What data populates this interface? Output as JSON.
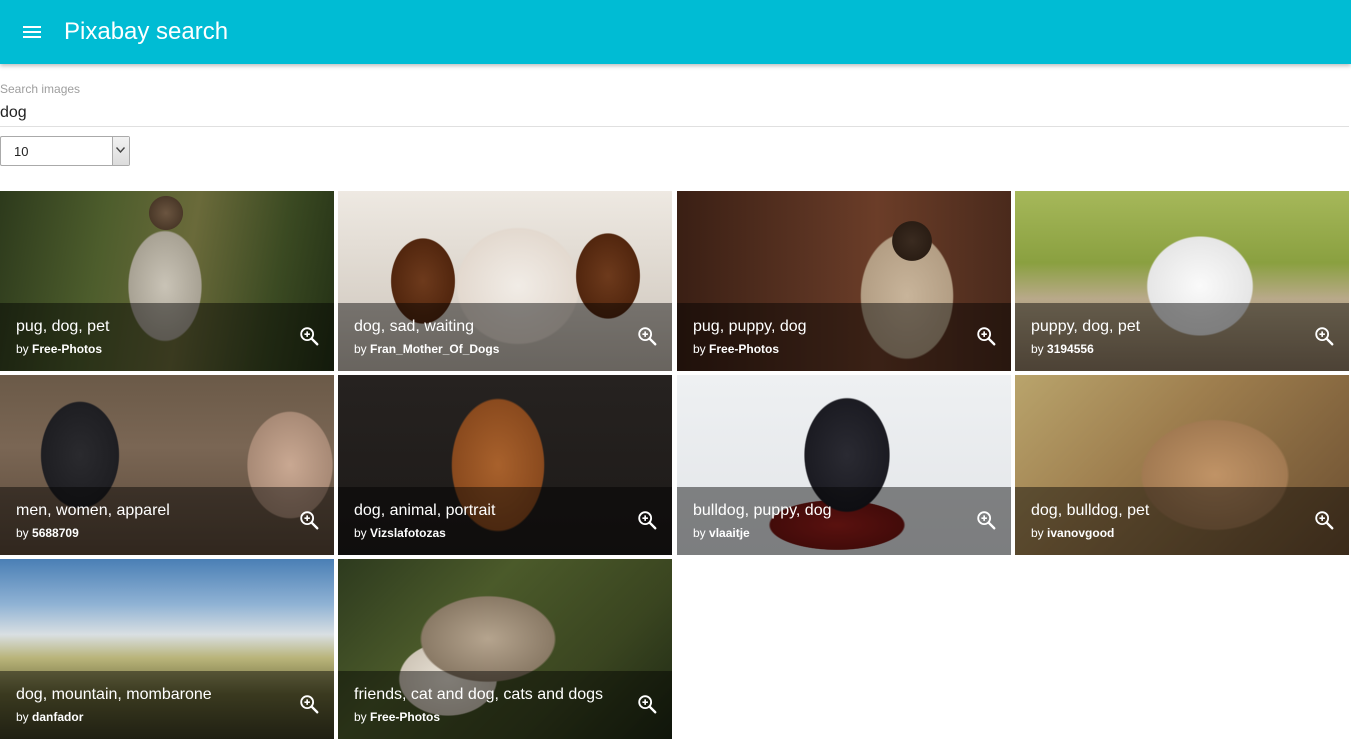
{
  "colors": {
    "accent": "#00bcd4"
  },
  "appbar": {
    "menu_icon": "menu-icon",
    "title": "Pixabay search"
  },
  "search": {
    "label": "Search images",
    "value": "dog"
  },
  "amount": {
    "selected": "10"
  },
  "results": [
    {
      "tags": "pug, dog, pet",
      "by": "by",
      "user": "Free-Photos",
      "zoom_icon": "zoom-in-icon"
    },
    {
      "tags": "dog, sad, waiting",
      "by": "by",
      "user": "Fran_Mother_Of_Dogs",
      "zoom_icon": "zoom-in-icon"
    },
    {
      "tags": "pug, puppy, dog",
      "by": "by",
      "user": "Free-Photos",
      "zoom_icon": "zoom-in-icon"
    },
    {
      "tags": "puppy, dog, pet",
      "by": "by",
      "user": "3194556",
      "zoom_icon": "zoom-in-icon"
    },
    {
      "tags": "men, women, apparel",
      "by": "by",
      "user": "5688709",
      "zoom_icon": "zoom-in-icon"
    },
    {
      "tags": "dog, animal, portrait",
      "by": "by",
      "user": "Vizslafotozas",
      "zoom_icon": "zoom-in-icon"
    },
    {
      "tags": "bulldog, puppy, dog",
      "by": "by",
      "user": "vlaaitje",
      "zoom_icon": "zoom-in-icon"
    },
    {
      "tags": "dog, bulldog, pet",
      "by": "by",
      "user": "ivanovgood",
      "zoom_icon": "zoom-in-icon"
    },
    {
      "tags": "dog, mountain, mombarone",
      "by": "by",
      "user": "danfador",
      "zoom_icon": "zoom-in-icon"
    },
    {
      "tags": "friends, cat and dog, cats and dogs",
      "by": "by",
      "user": "Free-Photos",
      "zoom_icon": "zoom-in-icon"
    }
  ]
}
